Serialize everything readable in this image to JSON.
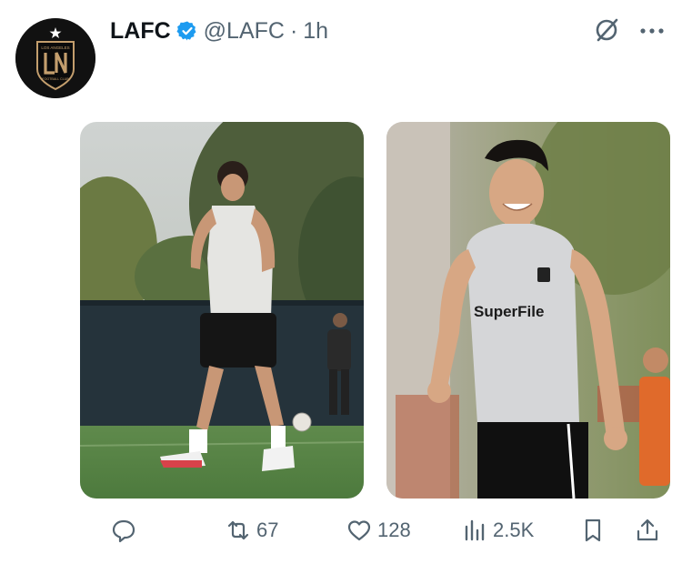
{
  "post": {
    "author_name": "LAFC",
    "handle": "@LAFC",
    "separator": "·",
    "time": "1h",
    "avatar": {
      "top_text": "LOS ANGELES",
      "crest_letters": "LAFC",
      "bottom_text": "FOOTBALL CLUB"
    }
  },
  "media": {
    "right_image_sponsor": "SuperFile"
  },
  "actions": {
    "reposts": "67",
    "likes": "128",
    "views": "2.5K"
  },
  "icons": {
    "verified": "verified-badge-icon",
    "grok": "grok-icon",
    "more": "more-icon",
    "reply": "reply-icon",
    "repost": "repost-icon",
    "like": "heart-icon",
    "views": "views-icon",
    "bookmark": "bookmark-icon",
    "share": "share-icon"
  },
  "colors": {
    "verified_blue": "#1d9bf0",
    "secondary_text": "#536471",
    "crest_gold": "#c39e6d"
  }
}
